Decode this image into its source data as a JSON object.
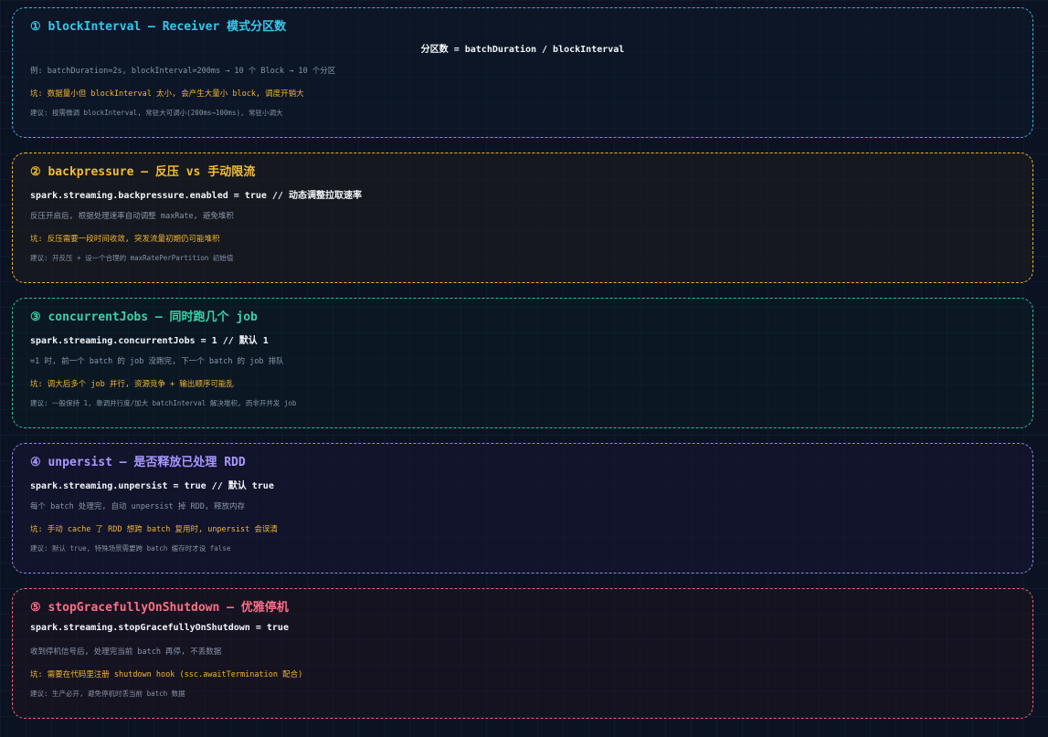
{
  "cards": [
    {
      "title": "① blockInterval — Receiver 模式分区数",
      "code": "分区数 = batchDuration / blockInterval",
      "desc": "例: batchDuration=2s, blockInterval=200ms → 10 个 Block → 10 个分区",
      "pit": "坑: 数据量小但 blockInterval 太小, 会产生大量小 block, 调度开销大",
      "tip": "建议: 按需微调 blockInterval, 常驻大可调小(200ms→100ms), 常驻小调大"
    },
    {
      "title": "② backpressure — 反压 vs 手动限流",
      "code": "spark.streaming.backpressure.enabled = true // 动态调整拉取速率",
      "desc": "反压开启后, 根据处理速率自动调整 maxRate, 避免堆积",
      "pit": "坑: 反压需要一段时间收敛, 突发流量初期仍可能堆积",
      "tip": "建议: 开反压 + 设一个合理的 maxRatePerPartition 初始值"
    },
    {
      "title": "③ concurrentJobs — 同时跑几个 job",
      "code": "spark.streaming.concurrentJobs = 1 // 默认 1",
      "desc": "=1 时, 前一个 batch 的 job 没跑完, 下一个 batch 的 job 排队",
      "pit": "坑: 调大后多个 job 并行, 资源竞争 + 输出顺序可能乱",
      "tip": "建议: 一般保持 1, 靠调并行度/加大 batchInterval 解决堆积, 而非开并发 job"
    },
    {
      "title": "④ unpersist — 是否释放已处理 RDD",
      "code": "spark.streaming.unpersist = true // 默认 true",
      "desc": "每个 batch 处理完, 自动 unpersist 掉 RDD, 释放内存",
      "pit": "坑: 手动 cache 了 RDD 想跨 batch 复用时, unpersist 会误清",
      "tip": "建议: 默认 true, 特殊场景需要跨 batch 缓存时才设 false"
    },
    {
      "title": "⑤ stopGracefullyOnShutdown — 优雅停机",
      "code": "spark.streaming.stopGracefullyOnShutdown = true",
      "desc": "收到停机信号后, 处理完当前 batch 再停, 不丢数据",
      "pit": "坑: 需要在代码里注册 shutdown hook (ssc.awaitTermination 配合)",
      "tip": "建议: 生产必开, 避免停机时丢当前 batch 数据"
    }
  ]
}
